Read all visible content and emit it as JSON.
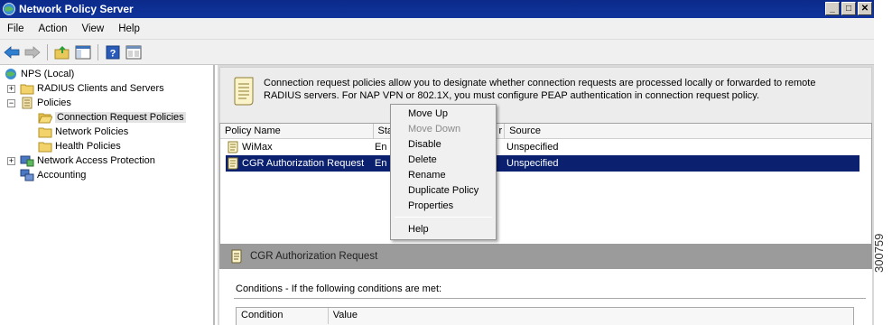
{
  "window": {
    "title": "Network Policy Server"
  },
  "window_buttons": {
    "minimize": "_",
    "maximize": "□",
    "close": "✕"
  },
  "menubar": {
    "items": [
      "File",
      "Action",
      "View",
      "Help"
    ]
  },
  "toolbar": {
    "icons": [
      "back-arrow-icon",
      "forward-arrow-icon",
      "up-folder-icon",
      "show-hide-console-tree-icon",
      "help-icon",
      "properties-icon"
    ]
  },
  "tree": {
    "root": "NPS (Local)",
    "radius": "RADIUS Clients and Servers",
    "policies": "Policies",
    "crp": "Connection Request Policies",
    "network_policies": "Network Policies",
    "health_policies": "Health Policies",
    "nap": "Network Access Protection",
    "accounting": "Accounting",
    "expand_plus": "+",
    "expand_minus": "−"
  },
  "description": {
    "text": "Connection request policies allow you to designate whether connection requests are processed locally or forwarded to remote RADIUS servers. For NAP VPN or 802.1X, you must configure PEAP authentication in connection request policy."
  },
  "list": {
    "headers": {
      "name": "Policy Name",
      "status": "Sta",
      "order": "r",
      "source": "Source"
    },
    "rows": [
      {
        "name": "WiMax",
        "status": "En",
        "source": "Unspecified"
      },
      {
        "name": "CGR Authorization Request",
        "status": "En",
        "source": "Unspecified"
      }
    ]
  },
  "context_menu": {
    "move_up": "Move Up",
    "move_down": "Move Down",
    "disable": "Disable",
    "delete": "Delete",
    "rename": "Rename",
    "duplicate": "Duplicate Policy",
    "properties": "Properties",
    "help": "Help"
  },
  "detail": {
    "title": "CGR Authorization Request",
    "conditions_label": "Conditions - If the following conditions are met:",
    "table_headers": {
      "condition": "Condition",
      "value": "Value"
    }
  },
  "figure_number": "300759",
  "colors": {
    "titlebar": "#0b2a8a",
    "selection": "#0b2170",
    "detail_header": "#9b9b9b"
  }
}
